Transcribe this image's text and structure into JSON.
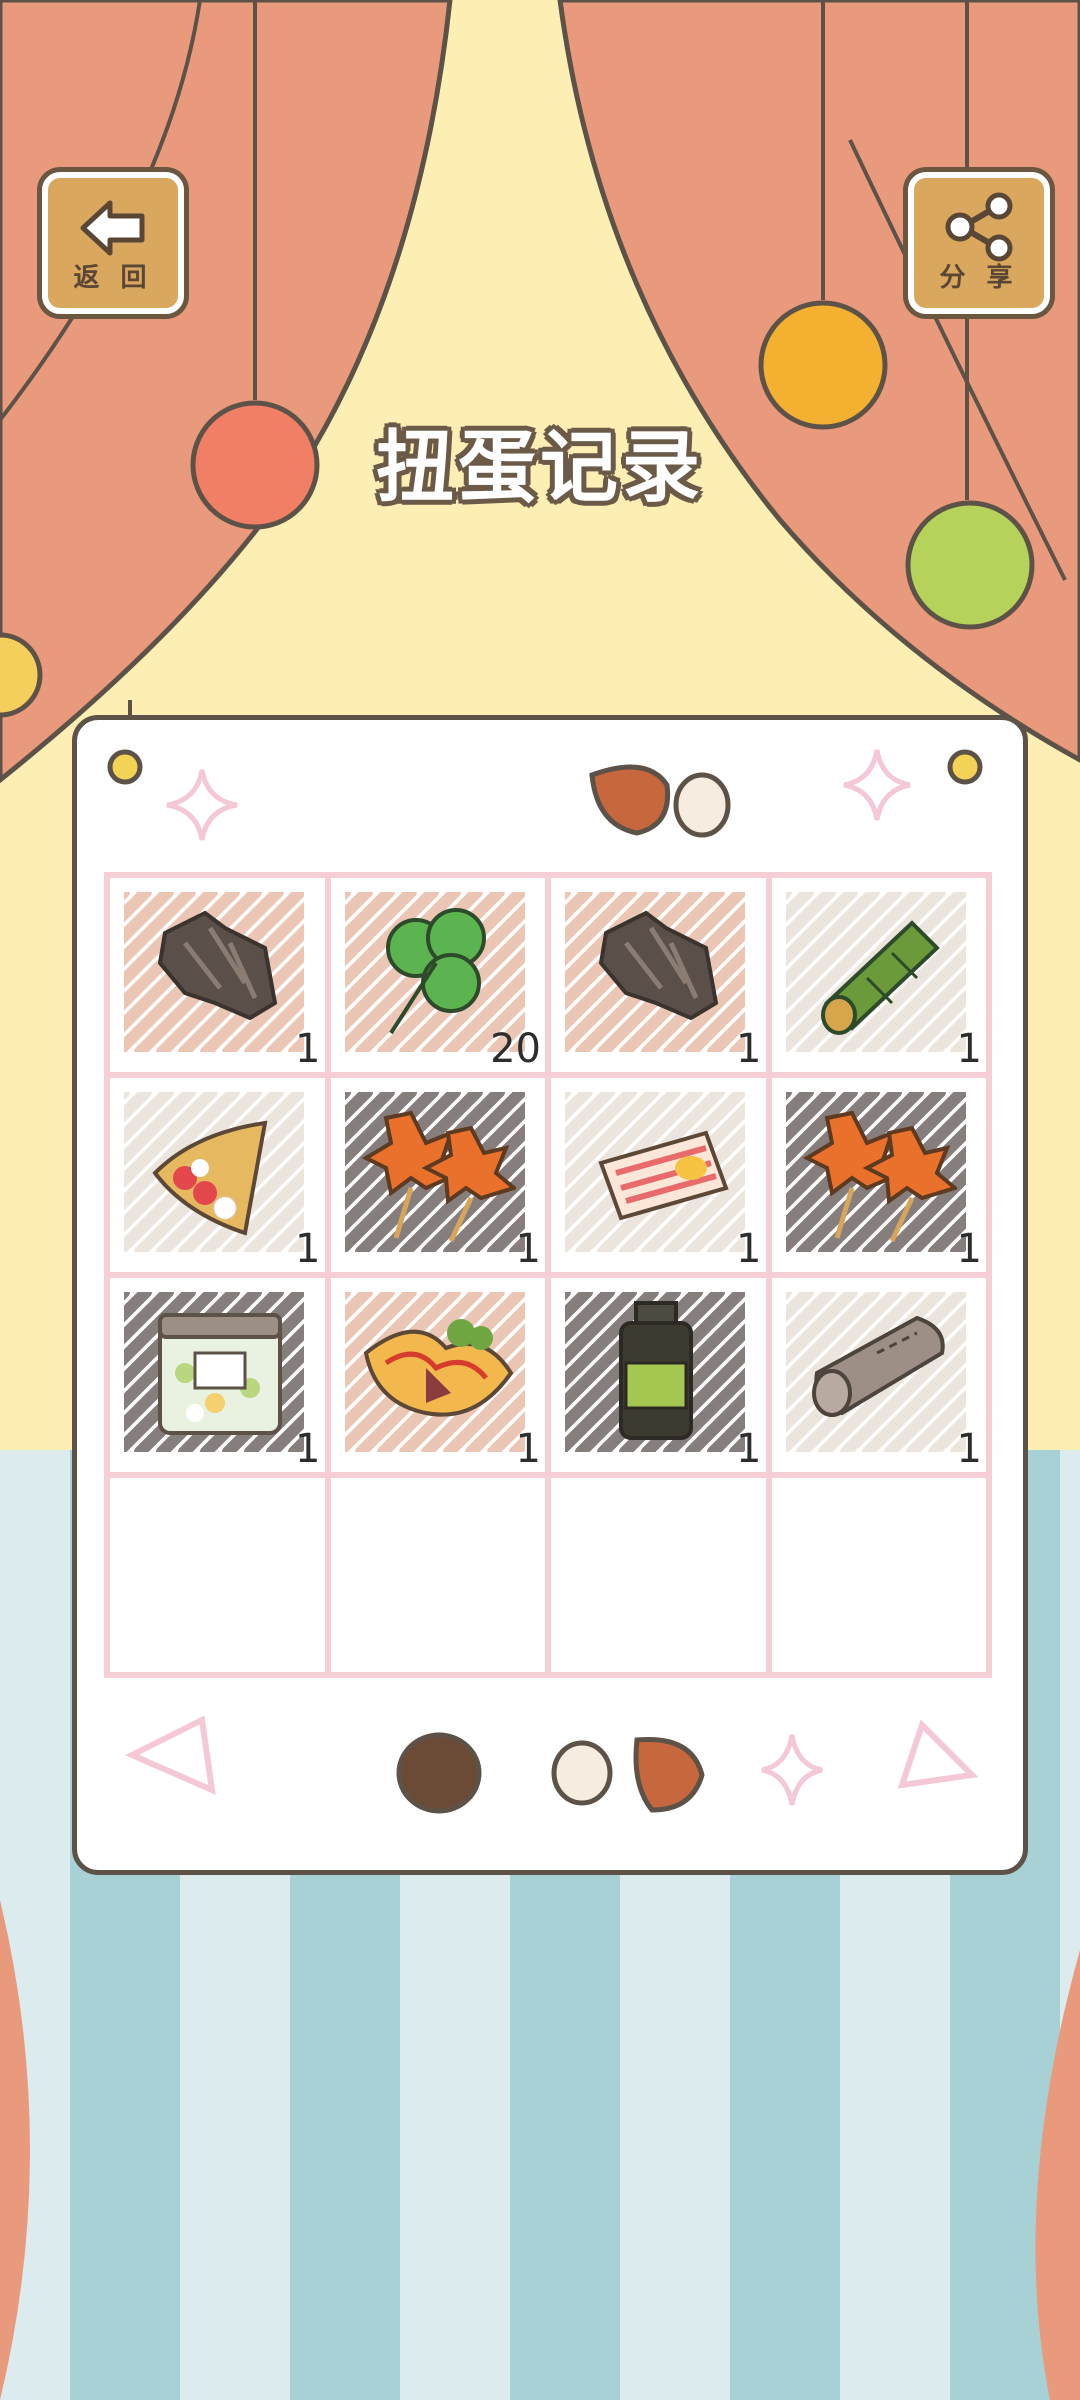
{
  "header": {
    "back_label": "返 回",
    "share_label": "分 享",
    "title": "扭蛋记录"
  },
  "colors": {
    "curtain": "#ea9a7c",
    "background": "#fdeeb4",
    "outline": "#5d5247",
    "grid_line": "#f6cfd6",
    "stripe_dark": "#a7d1d4",
    "stripe_light": "#dcebed"
  },
  "records": [
    {
      "name": "bark-icon",
      "count": "1"
    },
    {
      "name": "clover-icon",
      "count": "20"
    },
    {
      "name": "bark-icon",
      "count": "1"
    },
    {
      "name": "bamboo-icon",
      "count": "1"
    },
    {
      "name": "strawberry-crepe-icon",
      "count": "1"
    },
    {
      "name": "maple-leaf-skewer-icon",
      "count": "1"
    },
    {
      "name": "bacon-slice-icon",
      "count": "1"
    },
    {
      "name": "maple-leaf-skewer-icon",
      "count": "1"
    },
    {
      "name": "candy-jar-icon",
      "count": "1"
    },
    {
      "name": "omelette-icon",
      "count": "1"
    },
    {
      "name": "medicine-bottle-icon",
      "count": "1"
    },
    {
      "name": "cloth-roll-icon",
      "count": "1"
    },
    {
      "name": "",
      "count": ""
    },
    {
      "name": "",
      "count": ""
    },
    {
      "name": "",
      "count": ""
    },
    {
      "name": "",
      "count": ""
    }
  ]
}
